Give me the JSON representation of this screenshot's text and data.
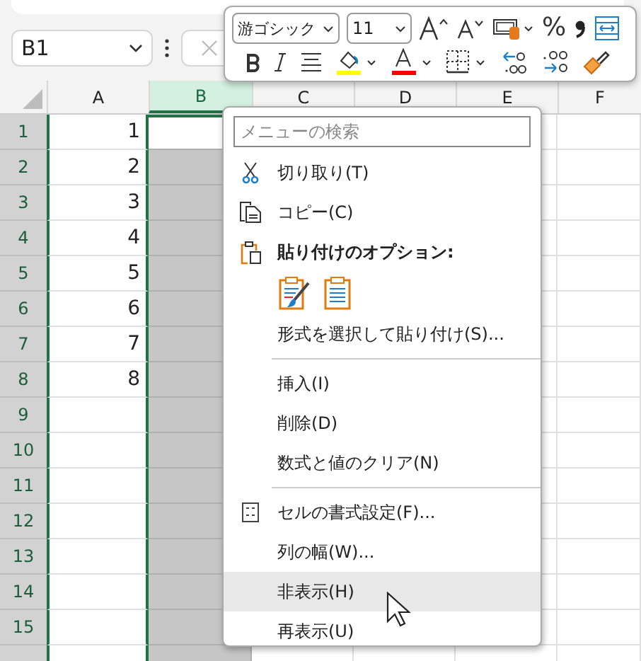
{
  "name_box": {
    "value": "B1"
  },
  "columns": [
    {
      "label": "A",
      "selected": false
    },
    {
      "label": "B",
      "selected": true
    },
    {
      "label": "C",
      "selected": false
    },
    {
      "label": "D",
      "selected": false
    },
    {
      "label": "E",
      "selected": false
    },
    {
      "label": "F",
      "selected": false
    }
  ],
  "rows": [
    {
      "label": "1",
      "value": "1"
    },
    {
      "label": "2",
      "value": "2"
    },
    {
      "label": "3",
      "value": "3"
    },
    {
      "label": "4",
      "value": "4"
    },
    {
      "label": "5",
      "value": "5"
    },
    {
      "label": "6",
      "value": "6"
    },
    {
      "label": "7",
      "value": "7"
    },
    {
      "label": "8",
      "value": "8"
    },
    {
      "label": "9",
      "value": ""
    },
    {
      "label": "10",
      "value": ""
    },
    {
      "label": "11",
      "value": ""
    },
    {
      "label": "12",
      "value": ""
    },
    {
      "label": "13",
      "value": ""
    },
    {
      "label": "14",
      "value": ""
    },
    {
      "label": "15",
      "value": ""
    }
  ],
  "mini_toolbar": {
    "font": "游ゴシック",
    "size": "11",
    "percent": "%"
  },
  "context_menu": {
    "search_placeholder": "メニューの検索",
    "items": [
      {
        "kind": "cut",
        "label": "切り取り(T)",
        "selected": false
      },
      {
        "kind": "copy",
        "label": "コピー(C)",
        "selected": false
      },
      {
        "kind": "pasteheader",
        "label": "貼り付けのオプション:"
      },
      {
        "kind": "pasteoptions"
      },
      {
        "kind": "command",
        "label": "形式を選択して貼り付け(S)...",
        "selected": false
      },
      {
        "kind": "separator"
      },
      {
        "kind": "command",
        "label": "挿入(I)",
        "selected": false
      },
      {
        "kind": "command",
        "label": "削除(D)",
        "selected": false
      },
      {
        "kind": "command",
        "label": "数式と値のクリア(N)",
        "selected": false
      },
      {
        "kind": "separator"
      },
      {
        "kind": "format",
        "label": "セルの書式設定(F)...",
        "selected": false
      },
      {
        "kind": "command",
        "label": "列の幅(W)...",
        "selected": false
      },
      {
        "kind": "command",
        "label": "非表示(H)",
        "selected": true
      },
      {
        "kind": "command",
        "label": "再表示(U)",
        "selected": false
      }
    ]
  }
}
